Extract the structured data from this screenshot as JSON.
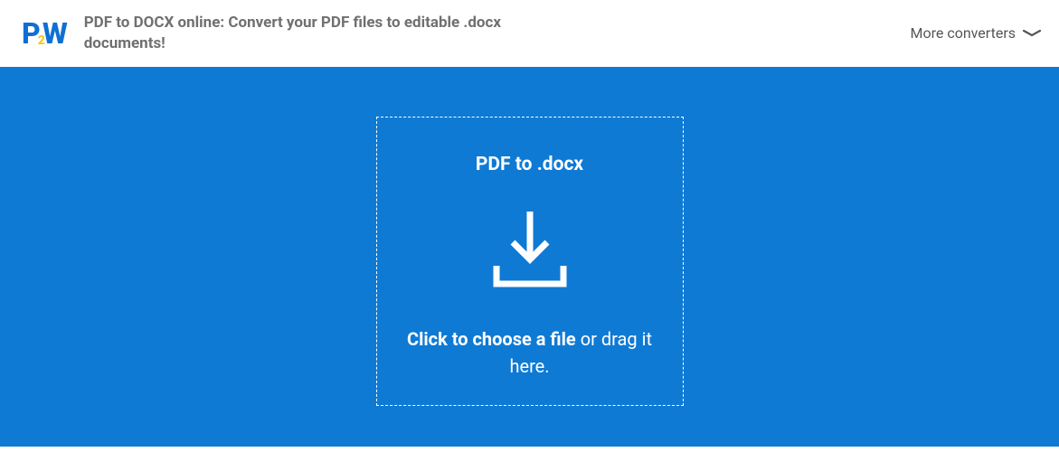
{
  "header": {
    "logo": {
      "p": "P",
      "two": "2",
      "w": "W"
    },
    "title": "PDF to DOCX online: Convert your PDF files to editable .docx documents!",
    "more_converters_label": "More converters"
  },
  "dropzone": {
    "title": "PDF to .docx",
    "cta_bold": "Click to choose a file",
    "cta_rest": " or drag it here."
  },
  "colors": {
    "brand_blue": "#0f7ad4",
    "brand_yellow": "#f5c518"
  }
}
